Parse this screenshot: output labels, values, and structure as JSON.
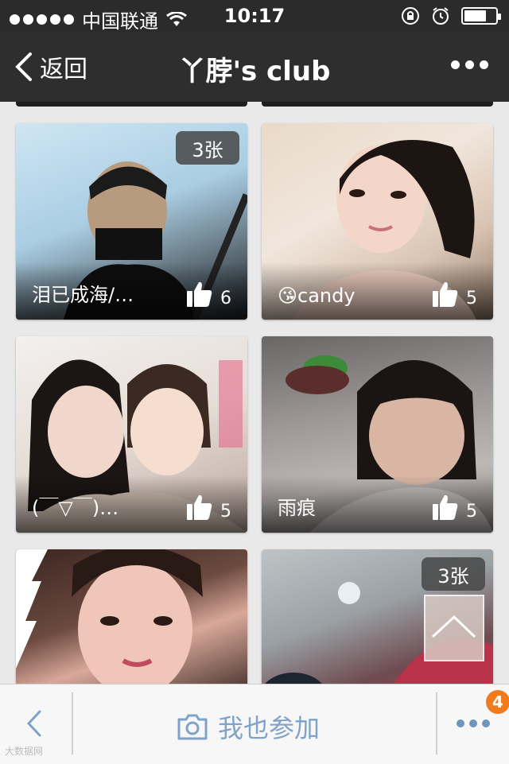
{
  "status_bar": {
    "carrier": "中国联通",
    "time": "10:17",
    "battery_level": 0.7,
    "signal_bars": 5
  },
  "nav": {
    "back_label": "返回",
    "title": "丫脖's club"
  },
  "posts": [
    {
      "name": "泪已成海/…",
      "likes": "6",
      "photo_count": "3张"
    },
    {
      "name": "😘candy",
      "likes": "5",
      "photo_count": ""
    },
    {
      "name": "(￣▽￣)…",
      "likes": "5",
      "photo_count": ""
    },
    {
      "name": "雨痕",
      "likes": "5",
      "photo_count": ""
    },
    {
      "name": "",
      "likes": "",
      "photo_count": ""
    },
    {
      "name": "",
      "likes": "",
      "photo_count": "3张"
    }
  ],
  "toolbar": {
    "join_label": "我也参加",
    "notification_count": "4"
  },
  "watermark": "大数据网",
  "colors": {
    "bar_dark": "#2e2e2e",
    "accent_blue": "#7fa3c8",
    "badge_orange": "#f07a1c"
  }
}
